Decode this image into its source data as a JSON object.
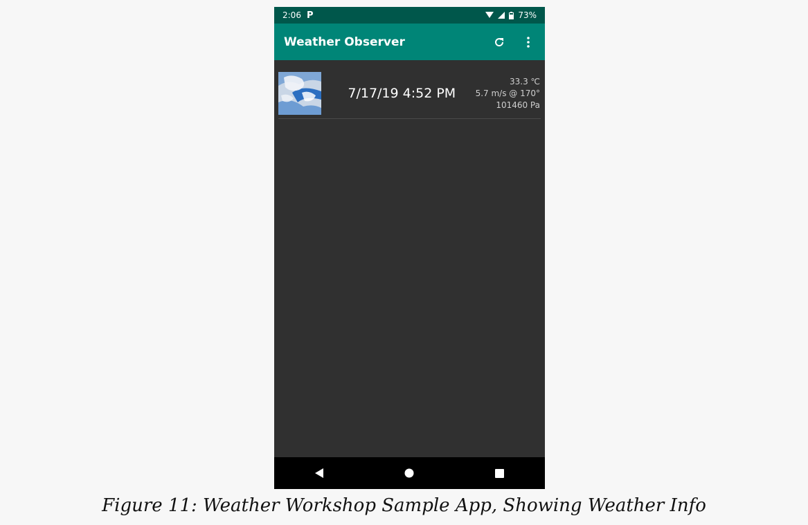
{
  "status_bar": {
    "time": "2:06",
    "battery": "73%"
  },
  "app_bar": {
    "title": "Weather Observer"
  },
  "icons": {
    "refresh": "refresh-icon",
    "overflow": "more-vert-icon"
  },
  "observation": {
    "date": "7/17/19 4:52 PM",
    "temperature": "33.3 ℃",
    "wind": "5.7 m/s @ 170°",
    "pressure": "101460 Pa"
  },
  "caption": "Figure 11: Weather Workshop Sample App, Showing Weather Info",
  "colors": {
    "app_bar": "#008577",
    "status_bar": "#00574b",
    "background": "#303030"
  }
}
